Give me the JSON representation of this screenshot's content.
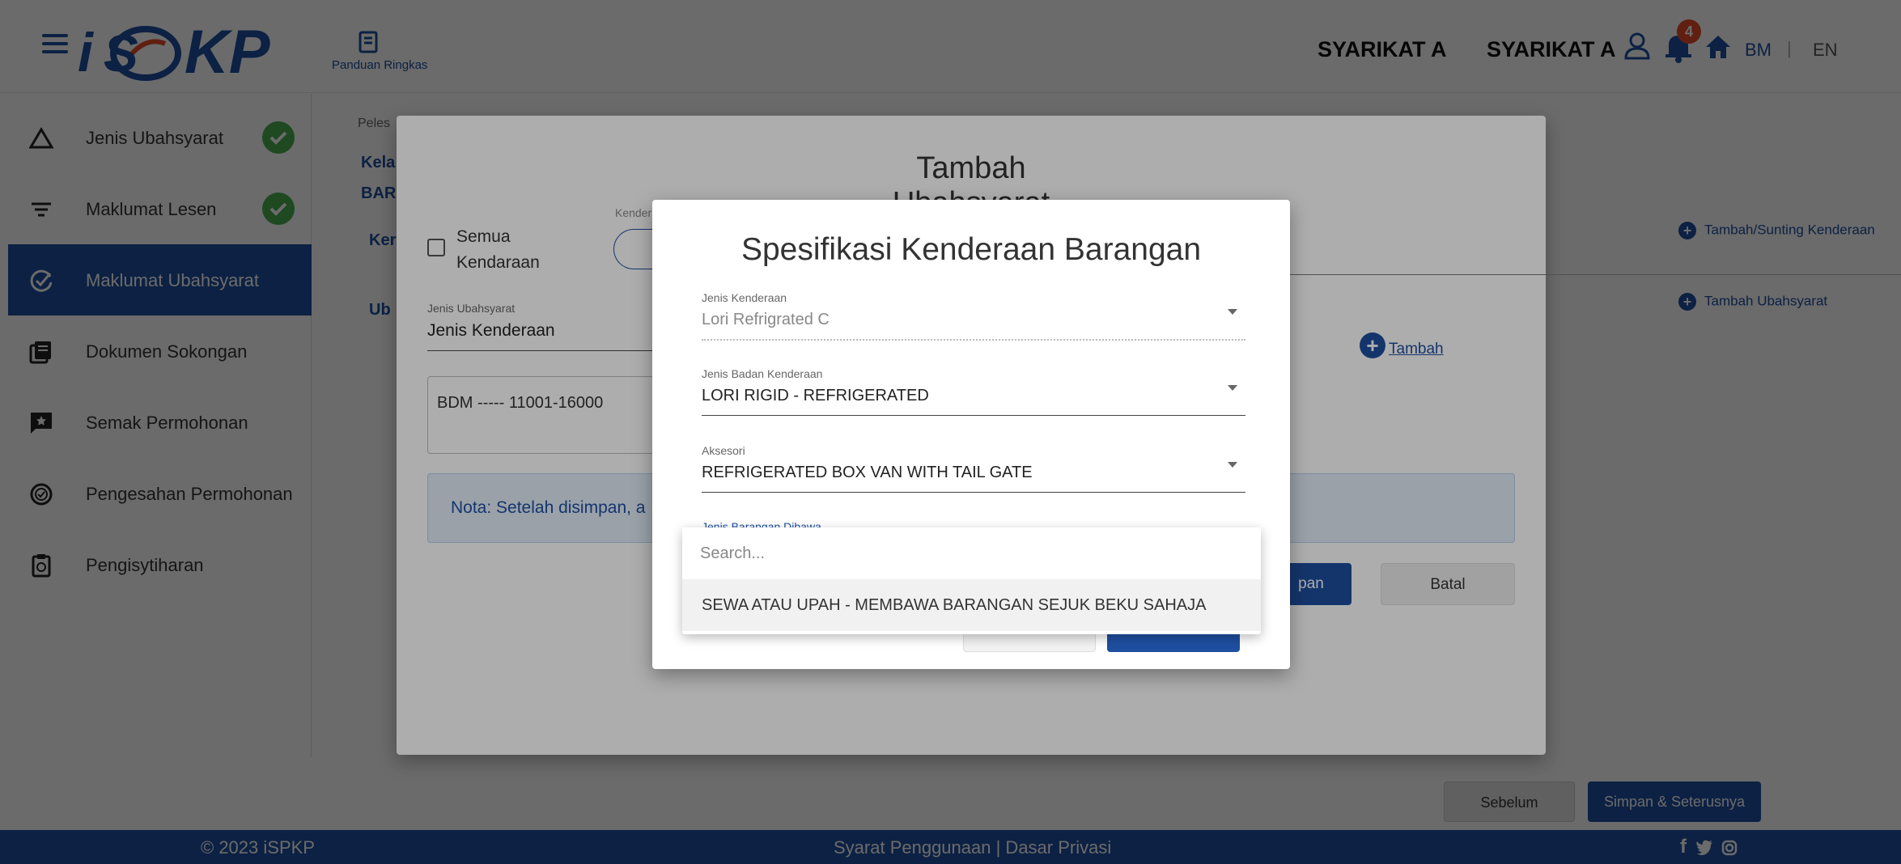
{
  "header": {
    "logo_text": "iSPKP",
    "guide_label": "Panduan Ringkas",
    "company_1": "SYARIKAT A",
    "company_2": "SYARIKAT A",
    "notification_count": "4",
    "lang_bm": "BM",
    "lang_separator": "|",
    "lang_en": "EN"
  },
  "sidebar": {
    "items": [
      {
        "label": "Jenis Ubahsyarat",
        "icon": "triangle-icon",
        "completed": true
      },
      {
        "label": "Maklumat Lesen",
        "icon": "filter-icon",
        "completed": true
      },
      {
        "label": "Maklumat Ubahsyarat",
        "icon": "add-check-icon",
        "active": true
      },
      {
        "label": "Dokumen Sokongan",
        "icon": "documents-icon"
      },
      {
        "label": "Semak Permohonan",
        "icon": "review-icon"
      },
      {
        "label": "Pengesahan Permohonan",
        "icon": "verify-icon"
      },
      {
        "label": "Pengisytiharan",
        "icon": "clipboard-icon"
      }
    ]
  },
  "main": {
    "breadcrumb": "Peles",
    "kelas": "Kela",
    "bar": "BAR",
    "ken": "Ker",
    "ubh": "Ub",
    "link_tambah_sunting": "Tambah/Sunting Kenderaan",
    "link_tambah_ubahsyarat": "Tambah Ubahsyarat",
    "btn_sebelum": "Sebelum",
    "btn_simpan_seterusnya": "Simpan & Seterusnya"
  },
  "dialog_tambah": {
    "title": "Tambah Ubahsyarat",
    "semua_line1": "Semua",
    "semua_line2": "Kendaraan",
    "kender_label": "Kender",
    "chip_x": "X",
    "jenis_ubahsyarat_label": "Jenis Ubahsyarat",
    "jenis_ubahsyarat_value": "Jenis Kenderaan",
    "textarea_value": "BDM ----- 11001-16000",
    "tambah_label": "Tambah",
    "note": "Nota: Setelah disimpan, a",
    "simpan_label": "pan",
    "batal_label": "Batal"
  },
  "dialog_spesifikasi": {
    "title": "Spesifikasi Kenderaan Barangan",
    "fields": [
      {
        "label": "Jenis Kenderaan",
        "value": "Lori Refrigrated C"
      },
      {
        "label": "Jenis Badan Kenderaan",
        "value": "LORI RIGID - REFRIGERATED"
      },
      {
        "label": "Aksesori",
        "value": "REFRIGERATED BOX VAN WITH TAIL GATE"
      },
      {
        "label": "Jenis Barangan Dibawa",
        "value": ""
      }
    ]
  },
  "dropdown": {
    "search_placeholder": "Search...",
    "options": [
      "SEWA ATAU UPAH - MEMBAWA BARANGAN SEJUK BEKU SAHAJA"
    ]
  },
  "footer": {
    "copyright": "© 2023 iSPKP",
    "links": "Syarat Penggunaan | Dasar Privasi",
    "social": "f     ◎"
  },
  "colors": {
    "primary": "#1e4fa0",
    "success": "#4caf50",
    "badge": "#e84d2a"
  }
}
